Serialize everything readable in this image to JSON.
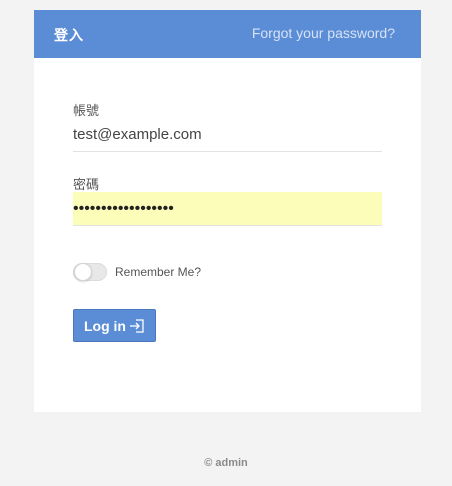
{
  "header": {
    "title": "登入",
    "forgot_link": "Forgot your password?"
  },
  "form": {
    "username": {
      "label": "帳號",
      "value": "test@example.com"
    },
    "password": {
      "label": "密碼",
      "value": "••••••••••••••••••"
    },
    "remember": {
      "label": "Remember Me?",
      "checked": false
    },
    "submit": {
      "label": "Log in",
      "icon": "login-icon"
    }
  },
  "footer": {
    "text": "© admin"
  },
  "colors": {
    "accent": "#5b8dd6",
    "autofill": "#fbfdb8",
    "background": "#f3f3f3"
  }
}
